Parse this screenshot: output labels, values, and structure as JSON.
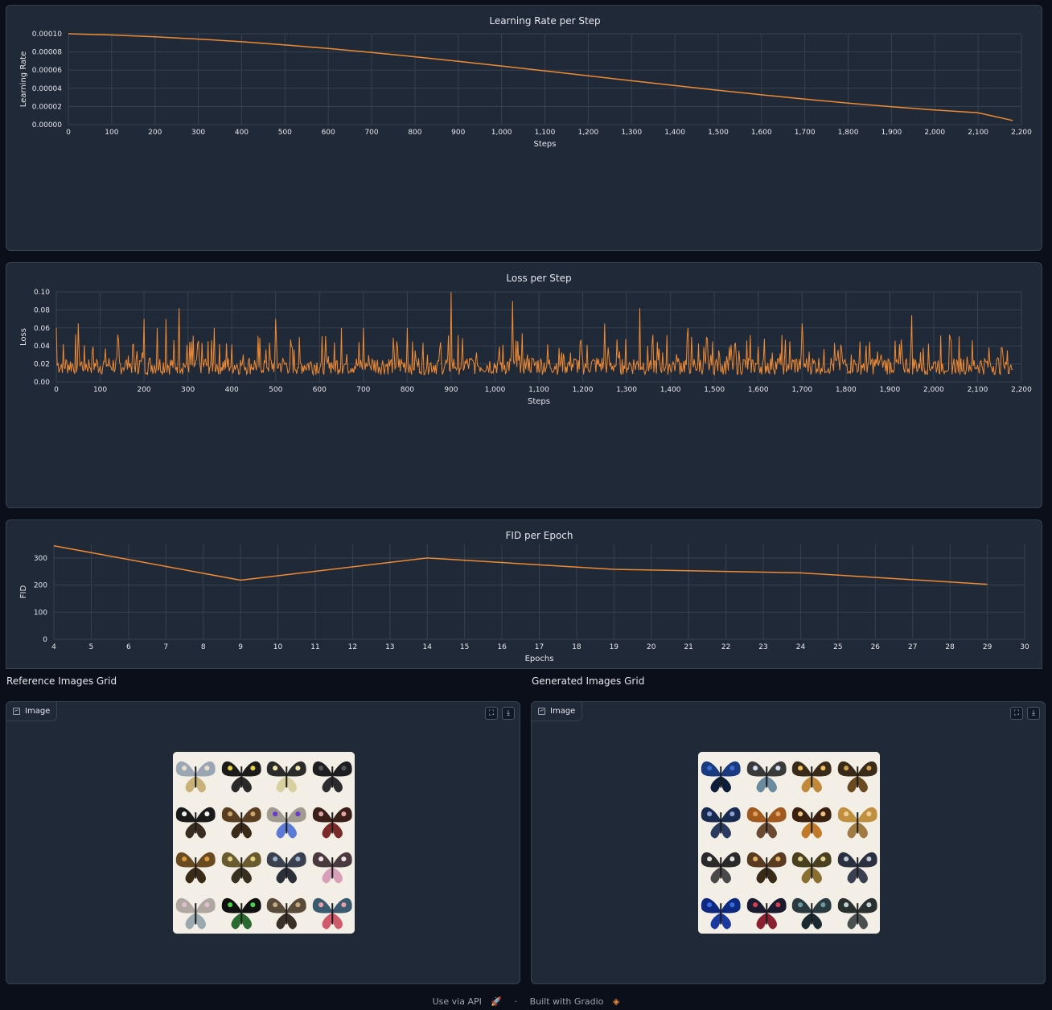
{
  "charts": {
    "lr": {
      "title": "Learning Rate per Step",
      "xlabel": "Steps",
      "ylabel": "Learning Rate",
      "xticks": [
        "0",
        "100",
        "200",
        "300",
        "400",
        "500",
        "600",
        "700",
        "800",
        "900",
        "1,000",
        "1,100",
        "1,200",
        "1,300",
        "1,400",
        "1,500",
        "1,600",
        "1,700",
        "1,800",
        "1,900",
        "2,000",
        "2,100",
        "2,200"
      ],
      "yticks": [
        "0.00000",
        "0.00002",
        "0.00004",
        "0.00006",
        "0.00008",
        "0.00010"
      ]
    },
    "loss": {
      "title": "Loss per Step",
      "xlabel": "Steps",
      "ylabel": "Loss",
      "xticks": [
        "0",
        "100",
        "200",
        "300",
        "400",
        "500",
        "600",
        "700",
        "800",
        "900",
        "1,000",
        "1,100",
        "1,200",
        "1,300",
        "1,400",
        "1,500",
        "1,600",
        "1,700",
        "1,800",
        "1,900",
        "2,000",
        "2,100",
        "2,200"
      ],
      "yticks": [
        "0.00",
        "0.02",
        "0.04",
        "0.06",
        "0.08",
        "0.10"
      ]
    },
    "fid": {
      "title": "FID per Epoch",
      "xlabel": "Epochs",
      "ylabel": "FID",
      "xticks": [
        "4",
        "5",
        "6",
        "7",
        "8",
        "9",
        "10",
        "11",
        "12",
        "13",
        "14",
        "15",
        "16",
        "17",
        "18",
        "19",
        "20",
        "21",
        "22",
        "23",
        "24",
        "25",
        "26",
        "27",
        "28",
        "29",
        "30"
      ],
      "yticks": [
        "0",
        "100",
        "200",
        "300"
      ]
    }
  },
  "chart_data": [
    {
      "type": "line",
      "title": "Learning Rate per Step",
      "xlabel": "Steps",
      "ylabel": "Learning Rate",
      "xlim": [
        0,
        2200
      ],
      "ylim": [
        0,
        0.0001
      ],
      "grid": true,
      "series": [
        {
          "x": [
            0,
            100,
            200,
            300,
            400,
            500,
            600,
            700,
            800,
            900,
            1000,
            1100,
            1200,
            1300,
            1400,
            1500,
            1600,
            1700,
            1800,
            1900,
            2000,
            2100,
            2180
          ],
          "y": [
            0.0001,
            9.87e-05,
            9.67e-05,
            9.42e-05,
            9.12e-05,
            8.77e-05,
            8.38e-05,
            7.94e-05,
            7.47e-05,
            6.97e-05,
            6.45e-05,
            5.92e-05,
            5.37e-05,
            4.83e-05,
            4.3e-05,
            3.78e-05,
            3.28e-05,
            2.81e-05,
            2.37e-05,
            1.97e-05,
            1.61e-05,
            1.3e-05,
            4.6e-06
          ]
        }
      ]
    },
    {
      "type": "line",
      "title": "Loss per Step",
      "xlabel": "Steps",
      "ylabel": "Loss",
      "xlim": [
        0,
        2200
      ],
      "ylim": [
        0,
        0.1
      ],
      "grid": true,
      "series": [
        {
          "x": [
            0,
            10,
            20,
            30,
            50,
            80,
            120,
            160,
            200,
            230,
            250,
            270,
            280,
            300,
            330,
            360,
            400,
            440,
            480,
            500,
            520,
            560,
            600,
            650,
            700,
            750,
            800,
            840,
            880,
            900,
            940,
            980,
            1020,
            1040,
            1080,
            1120,
            1160,
            1200,
            1250,
            1300,
            1330,
            1360,
            1400,
            1440,
            1480,
            1520,
            1560,
            1600,
            1640,
            1680,
            1700,
            1740,
            1780,
            1820,
            1860,
            1900,
            1940,
            1950,
            1980,
            2020,
            2060,
            2100,
            2140,
            2180
          ],
          "y": [
            0.06,
            0.04,
            0.05,
            0.03,
            0.065,
            0.03,
            0.045,
            0.035,
            0.07,
            0.06,
            0.07,
            0.05,
            0.082,
            0.04,
            0.05,
            0.06,
            0.045,
            0.05,
            0.04,
            0.07,
            0.04,
            0.05,
            0.045,
            0.06,
            0.06,
            0.05,
            0.06,
            0.04,
            0.05,
            0.1,
            0.04,
            0.045,
            0.05,
            0.09,
            0.04,
            0.05,
            0.045,
            0.04,
            0.065,
            0.04,
            0.082,
            0.05,
            0.045,
            0.06,
            0.05,
            0.045,
            0.05,
            0.04,
            0.045,
            0.05,
            0.065,
            0.05,
            0.055,
            0.045,
            0.04,
            0.05,
            0.045,
            0.074,
            0.05,
            0.04,
            0.045,
            0.04,
            0.05,
            0.045
          ]
        }
      ]
    },
    {
      "type": "line",
      "title": "FID per Epoch",
      "xlabel": "Epochs",
      "ylabel": "FID",
      "xlim": [
        4,
        30
      ],
      "ylim": [
        0,
        350
      ],
      "grid": true,
      "series": [
        {
          "x": [
            4,
            9,
            14,
            19,
            24,
            29
          ],
          "y": [
            345,
            218,
            300,
            258,
            245,
            203
          ]
        }
      ]
    }
  ],
  "images": {
    "reference": {
      "section_label": "Reference Images Grid",
      "tag": "Image"
    },
    "generated": {
      "section_label": "Generated Images Grid",
      "tag": "Image"
    }
  },
  "footer": {
    "api": "Use via API",
    "sep": "·",
    "built": "Built with Gradio"
  },
  "colors": {
    "line": "#f08a33",
    "panel": "#1f2937",
    "grid": "#374151"
  }
}
